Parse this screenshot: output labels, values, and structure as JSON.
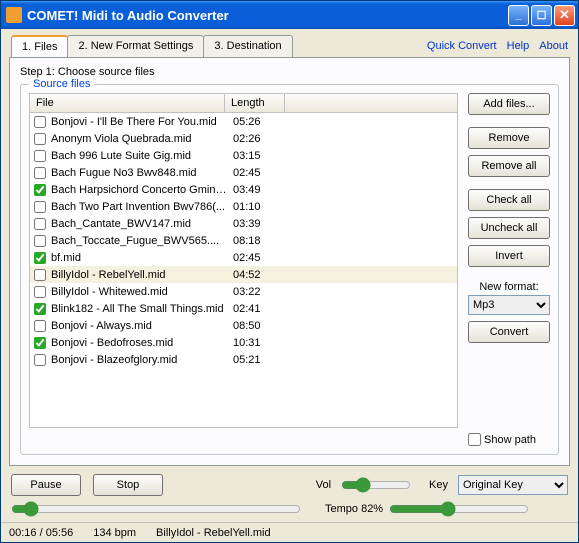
{
  "title": "COMET! Midi to Audio Converter",
  "links": {
    "quick_convert": "Quick Convert",
    "help": "Help",
    "about": "About"
  },
  "tabs": [
    {
      "label": "1. Files",
      "active": true
    },
    {
      "label": "2. New Format Settings",
      "active": false
    },
    {
      "label": "3. Destination",
      "active": false
    }
  ],
  "step_text": "Step 1: Choose source files",
  "groupbox_title": "Source files",
  "columns": {
    "file": "File",
    "length": "Length"
  },
  "files": [
    {
      "name": "Bonjovi - I'll Be There For You.mid",
      "length": "05:26",
      "checked": false,
      "selected": false
    },
    {
      "name": "Anonym Viola Quebrada.mid",
      "length": "02:26",
      "checked": false,
      "selected": false
    },
    {
      "name": "Bach 996 Lute Suite Gig.mid",
      "length": "03:15",
      "checked": false,
      "selected": false
    },
    {
      "name": "Bach Fugue No3 Bwv848.mid",
      "length": "02:45",
      "checked": false,
      "selected": false
    },
    {
      "name": "Bach Harpsichord Concerto Gmino...",
      "length": "03:49",
      "checked": true,
      "selected": false
    },
    {
      "name": "Bach Two Part Invention Bwv786(...",
      "length": "01:10",
      "checked": false,
      "selected": false
    },
    {
      "name": "Bach_Cantate_BWV147.mid",
      "length": "03:39",
      "checked": false,
      "selected": false
    },
    {
      "name": "Bach_Toccate_Fugue_BWV565....",
      "length": "08:18",
      "checked": false,
      "selected": false
    },
    {
      "name": "bf.mid",
      "length": "02:45",
      "checked": true,
      "selected": false
    },
    {
      "name": "BillyIdol - RebelYell.mid",
      "length": "04:52",
      "checked": false,
      "selected": true
    },
    {
      "name": "BillyIdol - Whitewed.mid",
      "length": "03:22",
      "checked": false,
      "selected": false
    },
    {
      "name": "Blink182 - All The Small Things.mid",
      "length": "02:41",
      "checked": true,
      "selected": false
    },
    {
      "name": "Bonjovi - Always.mid",
      "length": "08:50",
      "checked": false,
      "selected": false
    },
    {
      "name": "Bonjovi - Bedofroses.mid",
      "length": "10:31",
      "checked": true,
      "selected": false
    },
    {
      "name": "Bonjovi - Blazeofglory.mid",
      "length": "05:21",
      "checked": false,
      "selected": false
    }
  ],
  "buttons": {
    "add_files": "Add files...",
    "remove": "Remove",
    "remove_all": "Remove all",
    "check_all": "Check all",
    "uncheck_all": "Uncheck all",
    "invert": "Invert",
    "convert": "Convert",
    "pause": "Pause",
    "stop": "Stop"
  },
  "new_format_label": "New format:",
  "new_format_value": "Mp3",
  "show_path_label": "Show path",
  "show_path_checked": false,
  "vol_label": "Vol",
  "key_label": "Key",
  "key_value": "Original Key",
  "tempo_label": "Tempo 82%",
  "status": {
    "time": "00:16 / 05:56",
    "bpm": "134 bpm",
    "file": "BillyIdol - RebelYell.mid"
  }
}
